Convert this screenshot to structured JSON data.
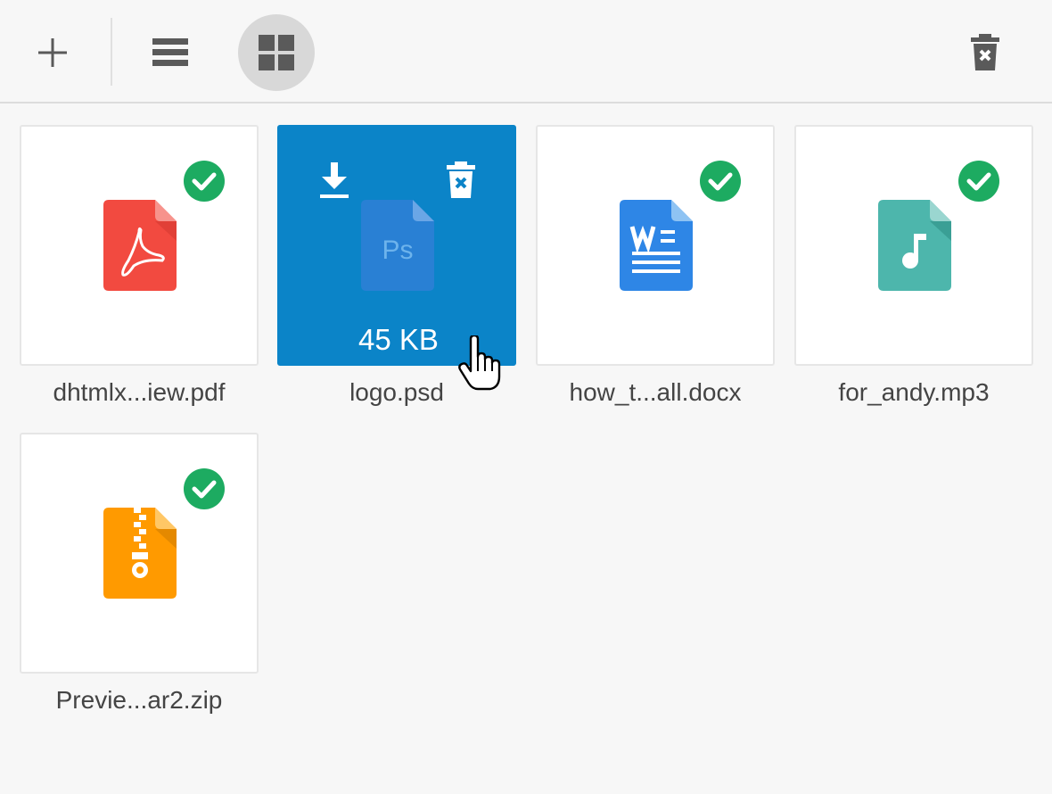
{
  "toolbar": {
    "add_icon": "plus-icon",
    "list_view_icon": "list-view-icon",
    "grid_view_icon": "grid-view-icon",
    "clear_icon": "trash-remove-icon",
    "active_view": "grid"
  },
  "files": [
    {
      "name": "dhtmlx...iew.pdf",
      "type": "pdf",
      "status": "uploaded",
      "color": "#f24a40"
    },
    {
      "name": "logo.psd",
      "type": "psd",
      "status": "hover",
      "size": "45 KB",
      "color": "#2f7fd6"
    },
    {
      "name": "how_t...all.docx",
      "type": "docx",
      "status": "uploaded",
      "color": "#2e86e6"
    },
    {
      "name": "for_andy.mp3",
      "type": "mp3",
      "status": "uploaded",
      "color": "#4db6ac"
    },
    {
      "name": "Previe...ar2.zip",
      "type": "zip",
      "status": "uploaded",
      "color": "#ff9a00"
    }
  ],
  "colors": {
    "success": "#1dab61",
    "hover_bg": "#0b84c8",
    "toolbar_icon": "#5a5a5a"
  }
}
